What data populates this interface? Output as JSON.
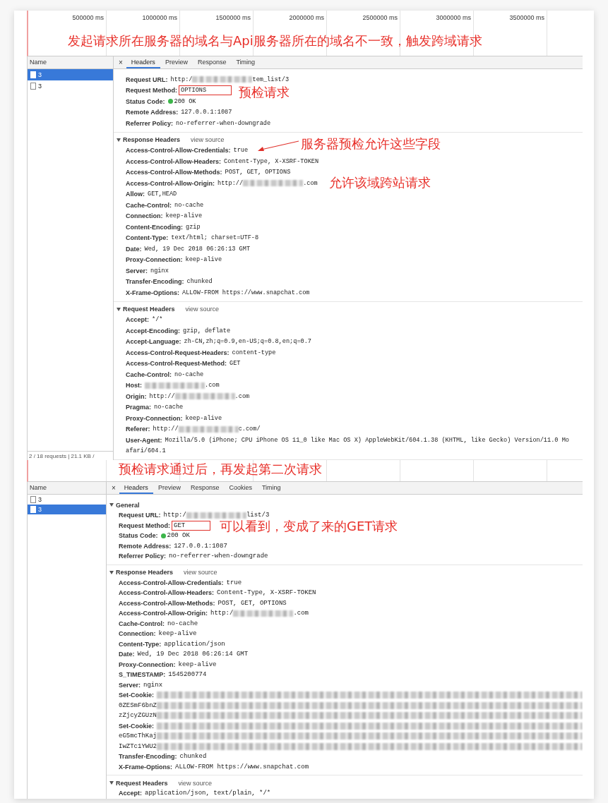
{
  "panels": [
    {
      "timeline": {
        "ticks": [
          "500000 ms",
          "1000000 ms",
          "1500000 ms",
          "2000000 ms",
          "2500000 ms",
          "3000000 ms",
          "3500000 ms"
        ],
        "caption": "发起请求所在服务器的域名与Api服务器所在的域名不一致，触发跨域请求"
      },
      "name_column": {
        "heading": "Name",
        "items": [
          {
            "label": "3",
            "selected": true
          },
          {
            "label": "3",
            "selected": false
          }
        ],
        "status": "2 / 18 requests | 21.1 KB /"
      },
      "close": "×",
      "tabs": [
        {
          "label": "Headers",
          "selected": true
        },
        {
          "label": "Preview",
          "selected": false
        },
        {
          "label": "Response",
          "selected": false
        },
        {
          "label": "Timing",
          "selected": false
        }
      ],
      "sections": [
        {
          "rows": [
            {
              "label": "Request URL:",
              "value": [
                {
                  "kind": "text",
                  "text": "http:/"
                },
                {
                  "kind": "blur"
                },
                {
                  "kind": "text",
                  "text": "tem_list/3"
                }
              ]
            },
            {
              "label": "Request Method:",
              "value": "OPTIONS",
              "boxed": true,
              "note": "预检请求"
            },
            {
              "label": "Status Code:",
              "kind": "status",
              "value": "200 OK"
            },
            {
              "label": "Remote Address:",
              "value": "127.0.0.1:1087"
            },
            {
              "label": "Referrer Policy:",
              "value": "no-referrer-when-downgrade"
            }
          ]
        },
        {
          "title": "Response Headers",
          "view_source": "view source",
          "expanded": true,
          "rows": [
            {
              "label": "Access-Control-Allow-Credentials:",
              "value": "true",
              "note": "服务器预检允许这些字段",
              "arrow": true
            },
            {
              "label": "Access-Control-Allow-Headers:",
              "value": "Content-Type, X-XSRF-TOKEN"
            },
            {
              "label": "Access-Control-Allow-Methods:",
              "value": "POST, GET, OPTIONS"
            },
            {
              "label": "Access-Control-Allow-Origin:",
              "value": [
                {
                  "kind": "text",
                  "text": "http://"
                },
                {
                  "kind": "blur"
                },
                {
                  "kind": "text",
                  "text": ".com"
                }
              ],
              "note": "允许该域跨站请求"
            },
            {
              "label": "Allow:",
              "value": "GET,HEAD"
            },
            {
              "label": "Cache-Control:",
              "value": "no-cache"
            },
            {
              "label": "Connection:",
              "value": "keep-alive"
            },
            {
              "label": "Content-Encoding:",
              "value": "gzip"
            },
            {
              "label": "Content-Type:",
              "value": "text/html; charset=UTF-8"
            },
            {
              "label": "Date:",
              "value": "Wed, 19 Dec 2018 06:26:13 GMT"
            },
            {
              "label": "Proxy-Connection:",
              "value": "keep-alive"
            },
            {
              "label": "Server:",
              "value": "nginx"
            },
            {
              "label": "Transfer-Encoding:",
              "value": "chunked"
            },
            {
              "label": "X-Frame-Options:",
              "value": "ALLOW-FROM https://www.snapchat.com"
            }
          ]
        },
        {
          "title": "Request Headers",
          "view_source": "view source",
          "expanded": true,
          "rows": [
            {
              "label": "Accept:",
              "value": "*/*"
            },
            {
              "label": "Accept-Encoding:",
              "value": "gzip, deflate"
            },
            {
              "label": "Accept-Language:",
              "value": "zh-CN,zh;q=0.9,en-US;q=0.8,en;q=0.7"
            },
            {
              "label": "Access-Control-Request-Headers:",
              "value": "content-type"
            },
            {
              "label": "Access-Control-Request-Method:",
              "value": "GET"
            },
            {
              "label": "Cache-Control:",
              "value": "no-cache"
            },
            {
              "label": "Host:",
              "value": [
                {
                  "kind": "blur"
                },
                {
                  "kind": "text",
                  "text": ".com"
                }
              ]
            },
            {
              "label": "Origin:",
              "value": [
                {
                  "kind": "text",
                  "text": "http://"
                },
                {
                  "kind": "blur"
                },
                {
                  "kind": "text",
                  "text": ".com"
                }
              ]
            },
            {
              "label": "Pragma:",
              "value": "no-cache"
            },
            {
              "label": "Proxy-Connection:",
              "value": "keep-alive"
            },
            {
              "label": "Referer:",
              "value": [
                {
                  "kind": "text",
                  "text": "http://"
                },
                {
                  "kind": "blur"
                },
                {
                  "kind": "text",
                  "text": "c.com/"
                }
              ]
            },
            {
              "label": "User-Agent:",
              "value": "Mozilla/5.0 (iPhone; CPU iPhone OS 11_0 like Mac OS X) AppleWebKit/604.1.38 (KHTML, like Gecko) Version/11.0 Mo"
            },
            {
              "value": "afari/604.1"
            }
          ]
        }
      ]
    },
    {
      "timeline": {
        "caption": "预检请求通过后，再发起第二次请求"
      },
      "name_column": {
        "heading": "Name",
        "items": [
          {
            "label": "3",
            "selected": false
          },
          {
            "label": "3",
            "selected": true
          }
        ]
      },
      "close": "×",
      "tabs": [
        {
          "label": "Headers",
          "selected": true
        },
        {
          "label": "Preview",
          "selected": false
        },
        {
          "label": "Response",
          "selected": false
        },
        {
          "label": "Cookies",
          "selected": false
        },
        {
          "label": "Timing",
          "selected": false
        }
      ],
      "sections": [
        {
          "title": "General",
          "expanded": true,
          "rows": [
            {
              "label": "Request URL:",
              "value": [
                {
                  "kind": "text",
                  "text": "http:/"
                },
                {
                  "kind": "blur"
                },
                {
                  "kind": "text",
                  "text": "list/3"
                }
              ]
            },
            {
              "label": "Request Method:",
              "value": "GET",
              "boxed": true,
              "note": "可以看到，变成了来的GET请求"
            },
            {
              "label": "Status Code:",
              "kind": "status",
              "value": "200 OK"
            },
            {
              "label": "Remote Address:",
              "value": "127.0.0.1:1087"
            },
            {
              "label": "Referrer Policy:",
              "value": "no-referrer-when-downgrade"
            }
          ]
        },
        {
          "title": "Response Headers",
          "view_source": "view source",
          "expanded": true,
          "rows": [
            {
              "label": "Access-Control-Allow-Credentials:",
              "value": "true"
            },
            {
              "label": "Access-Control-Allow-Headers:",
              "value": "Content-Type, X-XSRF-TOKEN"
            },
            {
              "label": "Access-Control-Allow-Methods:",
              "value": "POST, GET, OPTIONS"
            },
            {
              "label": "Access-Control-Allow-Origin:",
              "value": [
                {
                  "kind": "text",
                  "text": "http:/"
                },
                {
                  "kind": "blur"
                },
                {
                  "kind": "text",
                  "text": ".com"
                }
              ]
            },
            {
              "label": "Cache-Control:",
              "value": "no-cache"
            },
            {
              "label": "Connection:",
              "value": "keep-alive"
            },
            {
              "label": "Content-Type:",
              "value": "application/json"
            },
            {
              "label": "Date:",
              "value": "Wed, 19 Dec 2018 06:26:14 GMT"
            },
            {
              "label": "Proxy-Connection:",
              "value": "keep-alive"
            },
            {
              "label": "S_TIMESTAMP:",
              "value": "1545200774"
            },
            {
              "label": "Server:",
              "value": "nginx"
            },
            {
              "label": "Set-Cookie:",
              "value": [
                {
                  "kind": "blur-fill"
                }
              ]
            },
            {
              "value": [
                {
                  "kind": "text",
                  "text": "0ZESmF6bnZ"
                },
                {
                  "kind": "blur-fill"
                }
              ]
            },
            {
              "value": [
                {
                  "kind": "text",
                  "text": "zZjcyZGUzN"
                },
                {
                  "kind": "blur-fill"
                }
              ]
            },
            {
              "label": "Set-Cookie:",
              "value": [
                {
                  "kind": "blur-fill"
                }
              ]
            },
            {
              "value": [
                {
                  "kind": "text",
                  "text": "eG5mcThKaj"
                },
                {
                  "kind": "blur-fill"
                }
              ]
            },
            {
              "value": [
                {
                  "kind": "text",
                  "text": "IwZTc1YWU2"
                },
                {
                  "kind": "blur-fill"
                }
              ]
            },
            {
              "label": "Transfer-Encoding:",
              "value": "chunked"
            },
            {
              "label": "X-Frame-Options:",
              "value": "ALLOW-FROM https://www.snapchat.com"
            }
          ]
        },
        {
          "title": "Request Headers",
          "view_source": "view source",
          "expanded": true,
          "rows": [
            {
              "label": "Accept:",
              "value": "application/json, text/plain, */*"
            }
          ]
        }
      ]
    }
  ]
}
